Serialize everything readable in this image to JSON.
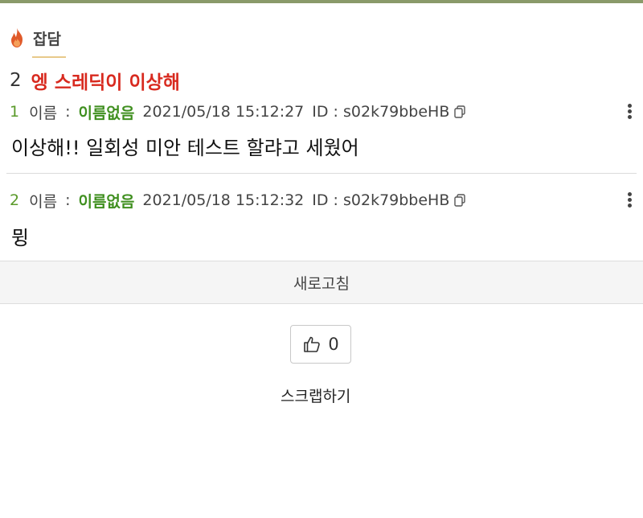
{
  "board": {
    "icon": "fire-icon",
    "title": "잡담"
  },
  "thread": {
    "count": "2",
    "title": "엥 스레딕이 이상해"
  },
  "posts": [
    {
      "number": "1",
      "name_label": "이름",
      "colon": ":",
      "author": "이름없음",
      "date": "2021/05/18 15:12:27",
      "id_text": "ID : s02k79bbeHB",
      "body": "이상해!! 일회성 미안 테스트 할랴고 세웠어"
    },
    {
      "number": "2",
      "name_label": "이름",
      "colon": ":",
      "author": "이름없음",
      "date": "2021/05/18 15:12:32",
      "id_text": "ID : s02k79bbeHB",
      "body": "뮝"
    }
  ],
  "refresh_label": "새로고침",
  "like": {
    "icon": "thumbs-up-icon",
    "count": "0"
  },
  "scrap_label": "스크랩하기",
  "colors": {
    "thread_title": "#d82a1f",
    "author": "#3f8f1f",
    "post_number": "#5a9a2a",
    "fire_icon": "#e05a2a"
  }
}
